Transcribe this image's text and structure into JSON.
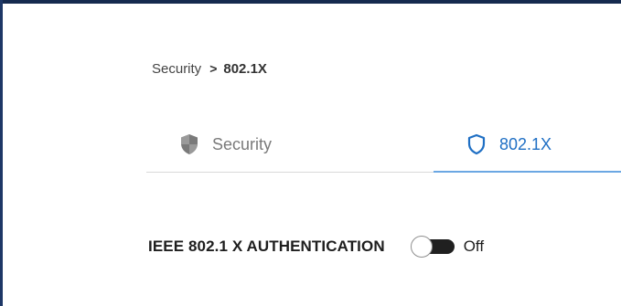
{
  "breadcrumb": {
    "parent": "Security",
    "separator": ">",
    "current": "802.1X"
  },
  "tabs": [
    {
      "label": "Security",
      "icon": "shield-filled-icon",
      "active": false
    },
    {
      "label": "802.1X",
      "icon": "shield-outline-icon",
      "active": true
    }
  ],
  "setting": {
    "label": "IEEE 802.1 X AUTHENTICATION",
    "toggle_state": "Off",
    "enabled": false
  },
  "colors": {
    "accent": "#1f6fc4",
    "active_underline": "#6ba7e3",
    "inactive_tab": "#7a7a7a",
    "toggle_track": "#202020",
    "frame": "#152a4f"
  }
}
